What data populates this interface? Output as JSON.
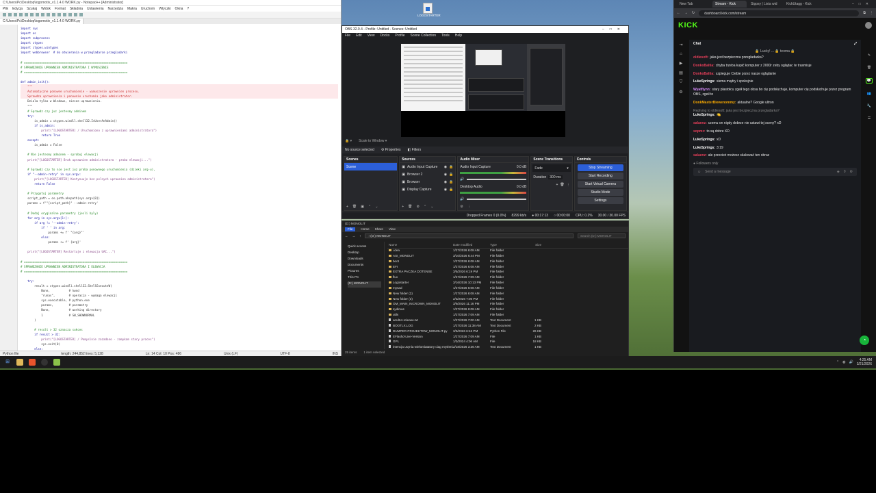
{
  "npp": {
    "title": "C:\\Users\\Pc\\Desktop\\logomotiv_v1.1.4.0 WORK.py - Notepad++ [Administrator]",
    "menu": [
      "Plik",
      "Edycja",
      "Szukaj",
      "Widok",
      "Format",
      "Składnia",
      "Ustawienia",
      "Narzędzia",
      "Makra",
      "Uruchom",
      "Wtyczki",
      "Okna",
      "?"
    ],
    "tabs": [
      "C:\\Users\\Pc\\Desktop\\logomotiv_v1.1.4.0 WORK.py"
    ],
    "code": [
      "import sys",
      "import os",
      "import subprocess",
      "import ctypes",
      "import ctypes.wintypes",
      "import webbrowser  # do otwierania w przegladarce przegladarki",
      "",
      "# ============================================================",
      "# SPRAWDZANIE UPRAWNIEN ADMINISTRATORA I WYMUSZENIE",
      "# ============================================================",
      "",
      "def admin_init():",
      "    \"\"\"",
      "    Automatyczne ponowne uruchomienie - wymuszenie uprawnien procesu.",
      "    Sprawdza uprawnienia i ponownie uruchamia jako administrator.",
      "    Dziala tylko w Windows, nizsze uprawnienia.",
      "    \"\"\"",
      "    # Sprawdz czy juz jestesmy adminem",
      "    try:",
      "        is_admin = ctypes.windll.shell32.IsUserAnAdmin()",
      "        if is_admin:",
      "            print(\"[LOGOSTARTER] / Uruchomiono z uprawnieniami administratora\")",
      "            return True",
      "    except:",
      "        is_admin = False",
      "",
      "    # Nie jestesmy adminem - sprobuj elewacji",
      "    print(\"[LOGOSTARTER] Brak uprawnien administratora - proba elewacji...\")",
      "",
      "    # Sprawdz czy to nie jest juz proba ponownego uruchomienia (dzieki arg-u),",
      "    if \"--admin-retry\" in sys.argv:",
      "        print(\"[LOGOSTARTER] Kontynuuje bez pelnych uprawnien administratora\")",
      "        return False",
      "",
      "    # Przygotuj parametry",
      "    script_path = os.path.abspath(sys.argv[0])",
      "    params = f'\"{script_path}\" --admin-retry'",
      "",
      "    # Dodaj oryginalne parametry (jesli byly)",
      "    for arg in sys.argv[1:]:",
      "        if arg != '--admin-retry':",
      "            if ' ' in arg:",
      "                params += f' \"{arg}\"'",
      "            else:",
      "                params += f' {arg}'",
      "",
      "    print(\"[LOGOSTARTER] Restartuje z elewacja UAC...\")",
      "",
      "# ============================================================",
      "# SPRAWDZANIE UPRAWNIEN ADMINISTRATORA I ELEWACJA",
      "# ============================================================",
      "",
      "    try:",
      "        result = ctypes.windll.shell32.ShellExecuteW(",
      "            None,           # hwnd",
      "            \"runas\",        # operacja - wymaga elewacji",
      "            sys.executable, # python.exe",
      "            params,         # parametry",
      "            None,           # working directory",
      "            1               # SW_SHOWNORMAL",
      "        )",
      "",
      "        # result > 32 oznacza sukces",
      "        if result > 32:",
      "            print(\"[LOGOSTARTER] / Pomyslnie zazadano - zamykam stary proces\")",
      "            sys.exit(0)",
      "        else:",
      "            print(f\"[LOGOSTARTER] X UAC elewacja nieudana (kod: {result})\")",
      "            return False",
      "",
      "    except Exception as e:",
      "        print(f\"[LOGOSTARTER] X Blad elewacji: {e}\")",
      "        return False"
    ],
    "status": {
      "left": "Python file",
      "length": "length: 244,852    lines: 5,128",
      "pos": "Ln: 14    Col: 10    Pos: 486",
      "eol": "Unix (LF)",
      "enc": "UTF-8",
      "ins": "INS"
    }
  },
  "desktop_icon": {
    "label": "LOGOSTARTER"
  },
  "obs": {
    "title": "OBS 32.0.4 - Profile: Untitled - Scenes: Untitled",
    "menu": [
      "File",
      "Edit",
      "View",
      "Docks",
      "Profile",
      "Scene Collection",
      "Tools",
      "Help"
    ],
    "no_source": "No source selected",
    "properties": "Properties",
    "filters": "Filters",
    "scenes": {
      "title": "Scenes",
      "items": [
        "Scene"
      ]
    },
    "sources": {
      "title": "Sources",
      "items": [
        "Audio Input Capture",
        "Browser 2",
        "Browser",
        "Display Capture"
      ]
    },
    "mixer": {
      "title": "Audio Mixer",
      "tracks": [
        {
          "name": "Audio Input Capture",
          "db": "0.0 dB"
        },
        {
          "name": "Desktop Audio",
          "db": "0.0 dB"
        }
      ]
    },
    "transitions": {
      "title": "Scene Transitions",
      "type": "Fade",
      "duration_label": "Duration",
      "duration": "300 ms"
    },
    "controls": {
      "title": "Controls",
      "buttons": [
        "Stop Streaming",
        "Start Recording",
        "Start Virtual Camera",
        "Studio Mode",
        "Settings"
      ]
    },
    "status": {
      "dropped": "Dropped Frames 0 (0.0%)",
      "kbps": "8299 kb/s",
      "live": "00:17:13",
      "rec": "00:00:00",
      "cpu": "CPU: 0.2%",
      "fps": "30.00 / 30.00 FPS"
    }
  },
  "explorer": {
    "title": "(D:) MONOLIT",
    "ribbon": [
      "File",
      "Home",
      "Share",
      "View"
    ],
    "address": "› (D:) MONOLIT",
    "search": "Search (D:) MONOLIT",
    "nav": [
      "Quick access",
      "Desktop",
      "Downloads",
      "Documents",
      "Pictures",
      "This PC",
      "(D:) MONOLIT"
    ],
    "columns": [
      "Name",
      "Date modified",
      "Type",
      "Size"
    ],
    "rows": [
      {
        "name": ".idea",
        "date": "1/27/2026 6:08 AM",
        "type": "File folder",
        "size": "",
        "folder": true
      },
      {
        "name": "ASI_MONOLIT",
        "date": "3/10/2026 6:44 PM",
        "type": "File folder",
        "size": "",
        "folder": true
      },
      {
        "name": "boot",
        "date": "1/27/2026 6:08 AM",
        "type": "File folder",
        "size": "",
        "folder": true
      },
      {
        "name": "EFI",
        "date": "1/27/2026 6:08 AM",
        "type": "File folder",
        "size": "",
        "folder": true
      },
      {
        "name": "EXTRA PACZKA DOTENSE",
        "date": "3/5/2026 6:19 PM",
        "type": "File folder",
        "size": "",
        "folder": true
      },
      {
        "name": "flux",
        "date": "1/27/2026 7:09 AM",
        "type": "File folder",
        "size": "",
        "folder": true
      },
      {
        "name": "Logostarter",
        "date": "3/16/2026 10:13 PM",
        "type": "File folder",
        "size": "",
        "folder": true
      },
      {
        "name": "mysad",
        "date": "1/27/2026 6:08 AM",
        "type": "File folder",
        "size": "",
        "folder": true
      },
      {
        "name": "New folder (2)",
        "date": "1/27/2026 6:08 AM",
        "type": "File folder",
        "size": "",
        "folder": true
      },
      {
        "name": "New folder (3)",
        "date": "2/3/2026 7:06 PM",
        "type": "File folder",
        "size": "",
        "folder": true
      },
      {
        "name": "OM_MAIN_INCROWN_MONOLIT",
        "date": "3/9/2026 11:16 PM",
        "type": "File folder",
        "size": "",
        "folder": true
      },
      {
        "name": "sydimus",
        "date": "1/27/2026 6:08 AM",
        "type": "File folder",
        "size": "",
        "folder": true
      },
      {
        "name": "utils",
        "date": "1/27/2026 7:09 AM",
        "type": "File folder",
        "size": "",
        "folder": true
      },
      {
        "name": "amd64-release.txt",
        "date": "1/27/2026 7:00 AM",
        "type": "Text Document",
        "size": "1 KB",
        "folder": false
      },
      {
        "name": "BOOTLX.LOG",
        "date": "1/27/2026 11:38 AM",
        "type": "Text Document",
        "size": "2 KB",
        "folder": false
      },
      {
        "name": "DUMPER-PROJEKTOW_MONOLIT.py",
        "date": "3/9/2026 6:46 PM",
        "type": "Python File",
        "size": "26 KB",
        "folder": false
      },
      {
        "name": "EFlashd-Live-Version",
        "date": "1/27/2026 7:09 AM",
        "type": "File",
        "size": "1 KB",
        "folder": false
      },
      {
        "name": "GPL",
        "date": "1/3/2024 4:06 AM",
        "type": "File",
        "size": "18 KB",
        "folder": false
      },
      {
        "name": "intencja usynia wielomiatatory ciag myslenia.txt",
        "date": "2/18/2026 3:36 AM",
        "type": "Text Document",
        "size": "1 KB",
        "folder": false
      }
    ],
    "status": {
      "count": "25 items",
      "selected": "1 item selected"
    }
  },
  "browser": {
    "tabs": [
      "New Tab",
      "Stream - Kick",
      "Sippsy | Lista wid",
      "KickUtagg - Kick"
    ],
    "url": "dashboard.kick.com/stream",
    "logo": "KICK",
    "chat_title": "Chat",
    "pinned": "🔒 Lucky! ... 🔒 teoma 🔒",
    "messages": [
      {
        "user": "oldiesoft:",
        "text": "jaka jest bezpieczna przegladarka?",
        "color": "#e83f5a",
        "reply": ""
      },
      {
        "user": "DonkoBaltia:",
        "text": "chyba trzeba kupić komputer z 2000r zeby oglądac te trasmisje",
        "color": "#e83f5a",
        "reply": ""
      },
      {
        "user": "DonkoBaltia:",
        "text": "szpieguje Ciebie przez nasze oglądanie",
        "color": "#e83f5a",
        "reply": ""
      },
      {
        "user": "LukeSprings:",
        "text": "siema mądry i spokojnie",
        "color": "#ffffff",
        "reply": ""
      },
      {
        "user": "Wyatflynn:",
        "text": "stary plastołcu zgeił tego obsa bo cię podsłuchuje, komputer cię podsłuchuje przez program OBS, zgeił to",
        "color": "#d98cff",
        "reply": ""
      },
      {
        "user": "DonkMasterBiewenommy:",
        "text": "aktualne? Google ultron",
        "color": "#f7a800",
        "reply": ""
      },
      {
        "user": "LukeSprings:",
        "text": "🍋",
        "color": "#ffffff",
        "reply": "Replying to oldiesoft: jaka jest bezpieczna przegladarka?"
      },
      {
        "user": "salaenz:",
        "text": "czemu on nigdy dobrze nie ustawi tej sceny? xD",
        "color": "#e83f5a",
        "reply": ""
      },
      {
        "user": "sopmz:",
        "text": "to są dobre XD",
        "color": "#e83f5a",
        "reply": ""
      },
      {
        "user": "LukeSprings:",
        "text": "xD",
        "color": "#ffffff",
        "reply": ""
      },
      {
        "user": "LukeSprings:",
        "text": "3:19",
        "color": "#ffffff",
        "reply": ""
      },
      {
        "user": "salaenz:",
        "text": "ale przecież możesz skalować ten obraz",
        "color": "#e83f5a",
        "reply": ""
      }
    ],
    "followers_only": "Followers only",
    "input_placeholder": "Send a message",
    "viewer_count": "0"
  },
  "taskbar": {
    "time": "4:25 AM",
    "date": "3/21/2026"
  },
  "colors": {
    "kick_green": "#53fc18",
    "obs_blue": "#2c5fd8"
  }
}
